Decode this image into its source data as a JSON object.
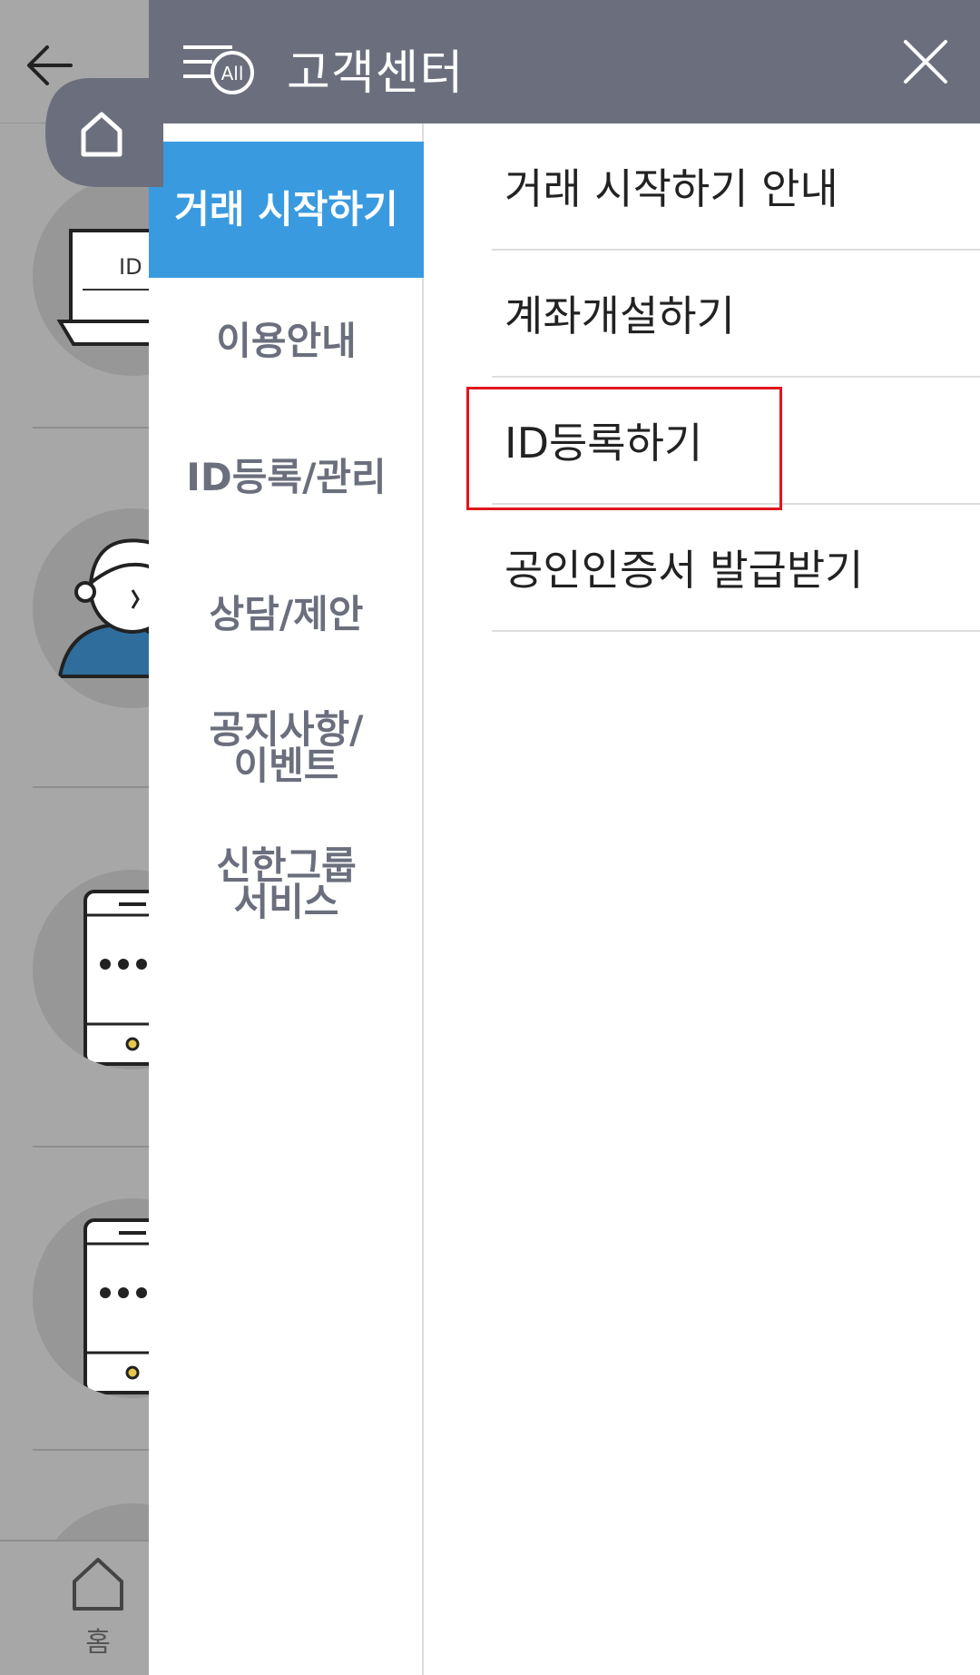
{
  "header": {
    "title": "고객센터",
    "all_badge": "All"
  },
  "categories": [
    {
      "label": "거래 시작하기",
      "active": true
    },
    {
      "label": "이용안내",
      "active": false
    },
    {
      "label": "ID등록/관리",
      "active": false
    },
    {
      "label": "상담/제안",
      "active": false
    },
    {
      "label": "공지사항/\n이벤트",
      "active": false
    },
    {
      "label": "신한그룹\n서비스",
      "active": false
    }
  ],
  "submenu": [
    {
      "label": "거래 시작하기 안내"
    },
    {
      "label": "계좌개설하기"
    },
    {
      "label": "ID등록하기"
    },
    {
      "label": "공인인증서 발급받기"
    }
  ],
  "background": {
    "laptop_text": "ID",
    "home_label": "홈"
  },
  "colors": {
    "header_bg": "#6b6f7d",
    "active_category": "#3a9ae0",
    "highlight": "#e0161e"
  }
}
